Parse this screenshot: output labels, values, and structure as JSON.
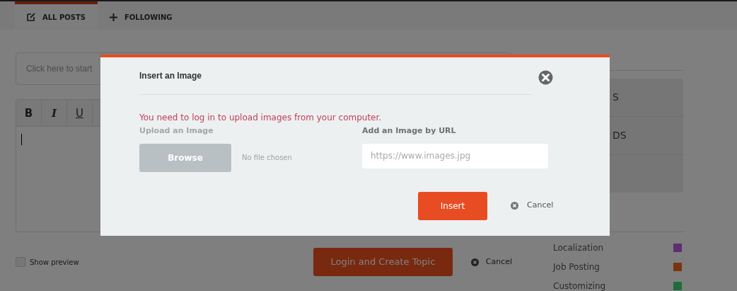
{
  "tabs": [
    {
      "label": "ALL POSTS",
      "selected": true
    },
    {
      "label": "FOLLOWING",
      "selected": false
    }
  ],
  "composer": {
    "title_placeholder": "Click here to start",
    "toolbar": [
      {
        "label": "B",
        "kind": "bold"
      },
      {
        "label": "I",
        "kind": "italic"
      },
      {
        "label": "U",
        "kind": "underline"
      }
    ],
    "show_preview": {
      "label": "Show preview",
      "checked": false
    },
    "submit": "Login and Create Topic",
    "cancel": "Cancel"
  },
  "sidebar": {
    "items": [
      "S",
      "DS"
    ],
    "categories": [
      {
        "name": "Localization",
        "color": "#5e2f70"
      },
      {
        "name": "Job Posting",
        "color": "#7a3510"
      },
      {
        "name": "Customizing",
        "color": "#1b6e3c"
      }
    ]
  },
  "modal": {
    "title": "Insert an Image",
    "error": "You need to log in to upload images from your computer.",
    "upload": {
      "label": "Upload an Image",
      "button": "Browse",
      "file_status": "No file chosen",
      "disabled": true
    },
    "url": {
      "label": "Add an Image by URL",
      "placeholder": "https://www.images.jpg"
    },
    "insert": "Insert",
    "cancel": "Cancel"
  }
}
